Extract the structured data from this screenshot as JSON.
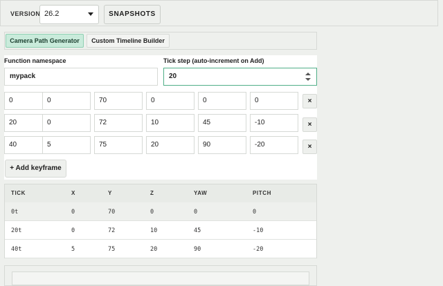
{
  "topbar": {
    "version_label": "VERSION",
    "version_value": "26.2",
    "snapshots_label": "SNAPSHOTS"
  },
  "tabs": [
    {
      "label": "Camera Path Generator",
      "active": true
    },
    {
      "label": "Custom Timeline Builder",
      "active": false
    }
  ],
  "form": {
    "namespace_label": "Function namespace",
    "namespace_value": "mypack",
    "tick_step_label": "Tick step (auto-increment on Add)",
    "tick_step_value": "20"
  },
  "keyframes": [
    [
      "0",
      "0",
      "70",
      "0",
      "0",
      "0"
    ],
    [
      "20",
      "0",
      "72",
      "10",
      "45",
      "-10"
    ],
    [
      "40",
      "5",
      "75",
      "20",
      "90",
      "-20"
    ]
  ],
  "delete_label": "×",
  "add_keyframe_label": "+ Add keyframe",
  "table": {
    "headers": [
      "TICK",
      "X",
      "Y",
      "Z",
      "YAW",
      "PITCH"
    ],
    "rows": [
      [
        "0t",
        "0",
        "70",
        "0",
        "0",
        "0"
      ],
      [
        "20t",
        "0",
        "72",
        "10",
        "45",
        "-10"
      ],
      [
        "40t",
        "5",
        "75",
        "20",
        "90",
        "-20"
      ]
    ]
  },
  "colors": {
    "accent": "#c9ebdb",
    "accent_border": "#8fd0b3",
    "focus": "#4fae87"
  }
}
